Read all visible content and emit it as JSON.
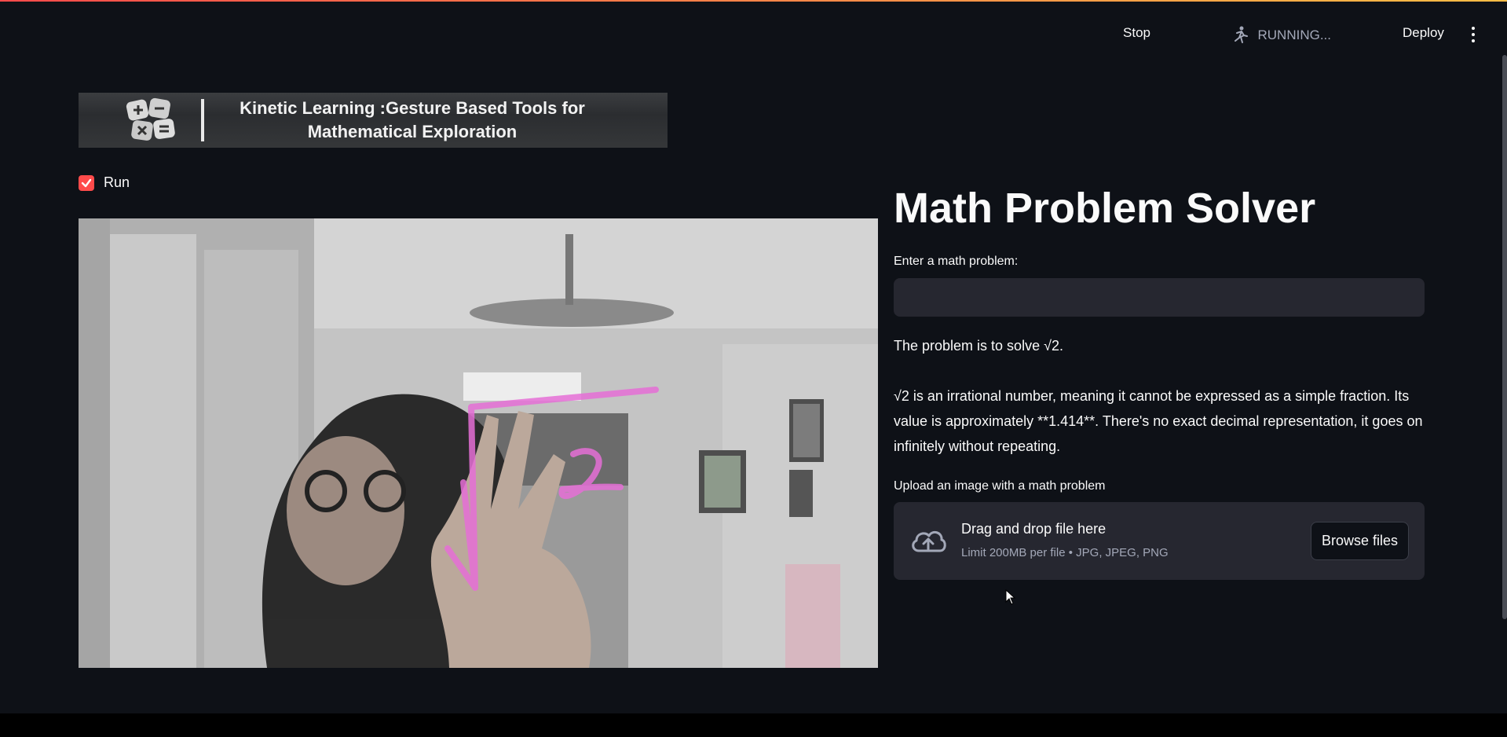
{
  "header": {
    "status": "RUNNING...",
    "stop_label": "Stop",
    "deploy_label": "Deploy",
    "status_icon": "running-person-icon",
    "menu_icon": "kebab-menu-icon"
  },
  "banner": {
    "title": "Kinetic Learning :Gesture Based Tools for Mathematical Exploration"
  },
  "run_checkbox": {
    "label": "Run",
    "checked": true
  },
  "solver": {
    "title": "Math Problem Solver",
    "input_label": "Enter a math problem:",
    "input_value": "",
    "answer_paragraphs": [
      "The problem is to solve √2.",
      "√2 is an irrational number, meaning it cannot be expressed as a simple fraction. Its value is approximately **1.414**. There's no exact decimal representation, it goes on infinitely without repeating."
    ],
    "upload_label": "Upload an image with a math problem",
    "drop_title": "Drag and drop file here",
    "drop_subtitle": "Limit 200MB per file • JPG, JPEG, PNG",
    "browse_label": "Browse files"
  },
  "colors": {
    "background": "#0e1117",
    "accent": "#ff4b4b",
    "input_bg": "#262730",
    "stroke": "#e56fd6"
  }
}
